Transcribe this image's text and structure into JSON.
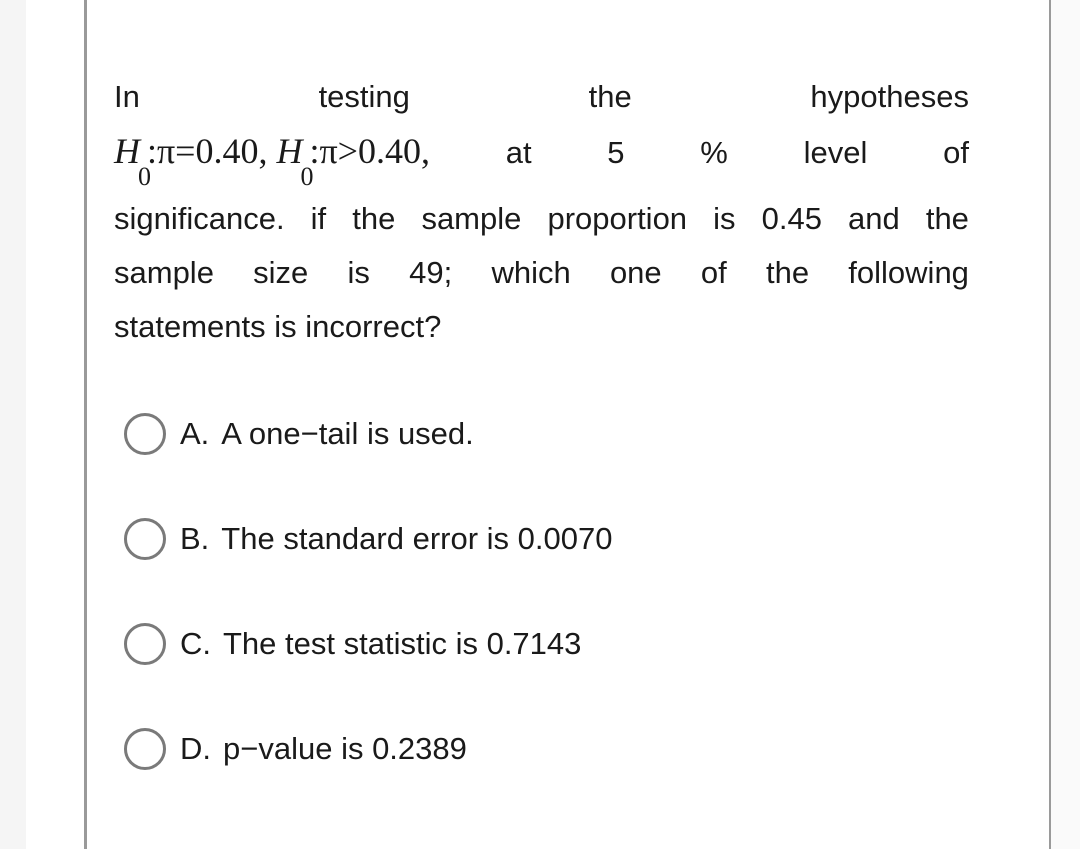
{
  "question": {
    "line1": [
      "In",
      "testing",
      "the",
      "hypotheses"
    ],
    "math": {
      "h0_symbol": "H",
      "h0_sub": "0",
      "h0_expr": ":π=0.40,",
      "h1_symbol": "H",
      "h1_sub": "0",
      "h1_expr": ":π>0.40,"
    },
    "line2_words": [
      "at",
      "5",
      "%",
      "level",
      "of"
    ],
    "line3_words": [
      "significance.",
      "if",
      "the",
      "sample",
      "proportion",
      "is",
      "0.45",
      "and",
      "the"
    ],
    "line4_words": [
      "sample",
      "size",
      "is",
      "49;",
      "which",
      "one",
      "of",
      "the",
      "following"
    ],
    "line5": "statements is incorrect?"
  },
  "options": [
    {
      "letter": "A.",
      "text": "A one−tail is used.",
      "selected": false
    },
    {
      "letter": "B.",
      "text": "The standard error is 0.0070",
      "selected": false
    },
    {
      "letter": "C.",
      "text": "The test statistic is 0.7143",
      "selected": false
    },
    {
      "letter": "D.",
      "text": "p−value is 0.2389",
      "selected": false
    }
  ]
}
